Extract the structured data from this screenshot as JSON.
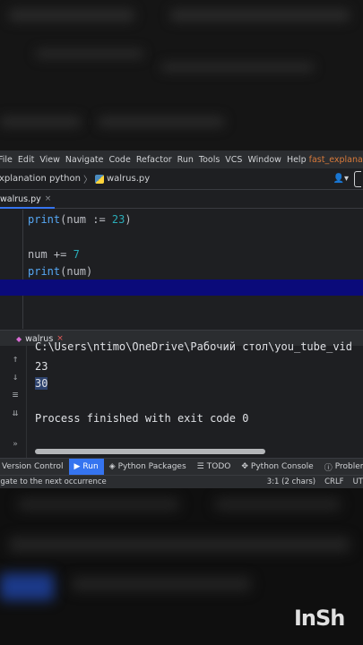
{
  "menu": [
    "File",
    "Edit",
    "View",
    "Navigate",
    "Code",
    "Refactor",
    "Run",
    "Tools",
    "VCS",
    "Window",
    "Help"
  ],
  "menu_project": "fast_explanation",
  "breadcrumb": {
    "project": "xplanation python",
    "file": "walrus.py"
  },
  "editor_tab": {
    "label": "walrus.py",
    "close": "×"
  },
  "code": {
    "line1": {
      "fn": "print",
      "open": "(num := ",
      "num": "23",
      "close": ")"
    },
    "line2": {
      "text": "num += ",
      "num": "7"
    },
    "line3": {
      "fn": "print",
      "rest": "(num)"
    }
  },
  "run_tab": {
    "label": "walrus",
    "close": "×"
  },
  "console": {
    "path": "C:\\Users\\ntimo\\OneDrive\\Рабочий стол\\you_tube_vid",
    "out1": "23",
    "out2": "30",
    "finished": "Process finished with exit code 0"
  },
  "toolstrip": [
    {
      "label": "Version Control",
      "icon": "branch-icon",
      "active": false
    },
    {
      "label": "Run",
      "icon": "play-icon",
      "active": true
    },
    {
      "label": "Python Packages",
      "icon": "layers-icon",
      "active": false
    },
    {
      "label": "TODO",
      "icon": "list-icon",
      "active": false
    },
    {
      "label": "Python Console",
      "icon": "python-icon",
      "active": false
    },
    {
      "label": "Problems",
      "icon": "info-icon",
      "active": false
    }
  ],
  "status": {
    "message": "igate to the next occurrence",
    "position": "3:1 (2 chars)",
    "line_sep": "CRLF",
    "encoding": "UT"
  },
  "watermark": "InSh",
  "colors": {
    "accent": "#3574f0",
    "current_line": "#0a0a7a",
    "number": "#2aacb8",
    "function": "#56a8f5"
  }
}
